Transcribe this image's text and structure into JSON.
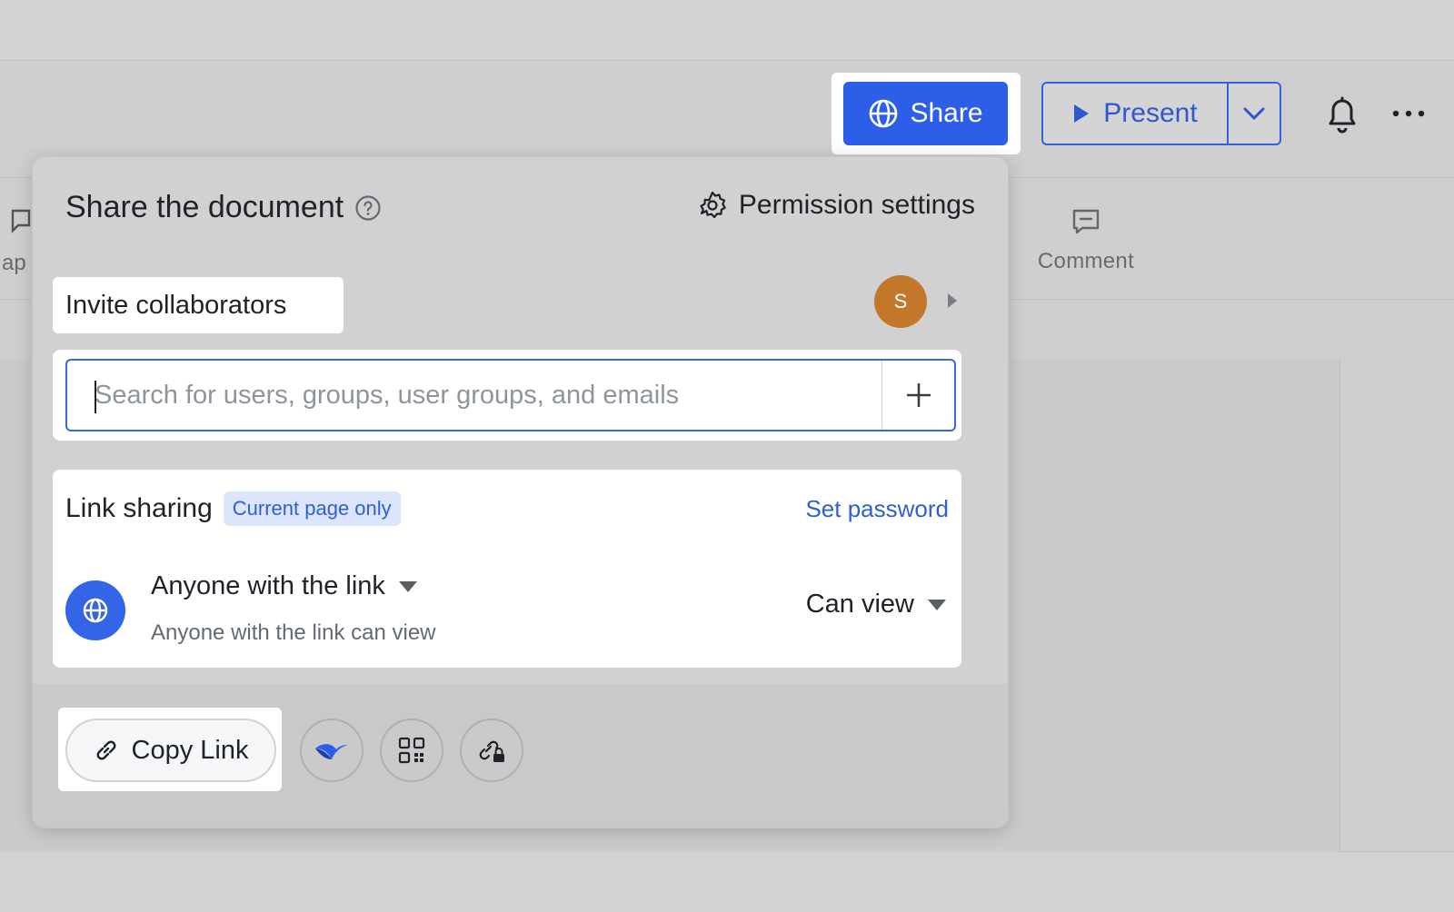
{
  "toolbar": {
    "share_label": "Share",
    "present_label": "Present"
  },
  "background_tools": {
    "partial_label": "ap",
    "comment_label": "Comment"
  },
  "popover": {
    "title": "Share the document",
    "permission_settings_label": "Permission settings",
    "invite_label": "Invite collaborators",
    "avatar_initial": "S",
    "search": {
      "placeholder": "Search for users, groups, user groups, and emails",
      "value": ""
    },
    "link_sharing": {
      "title": "Link sharing",
      "badge": "Current page only",
      "set_password_label": "Set password",
      "scope_label": "Anyone with the link",
      "scope_description": "Anyone with the link can view",
      "permission_label": "Can view"
    },
    "footer": {
      "copy_link_label": "Copy Link",
      "buttons": [
        "share-app-icon",
        "qr-code-icon",
        "link-lock-icon"
      ]
    }
  },
  "colors": {
    "accent": "#2d5ee8",
    "avatar": "#c2772b",
    "badge_bg": "#dbe5fb",
    "badge_text": "#2f5fd6"
  }
}
